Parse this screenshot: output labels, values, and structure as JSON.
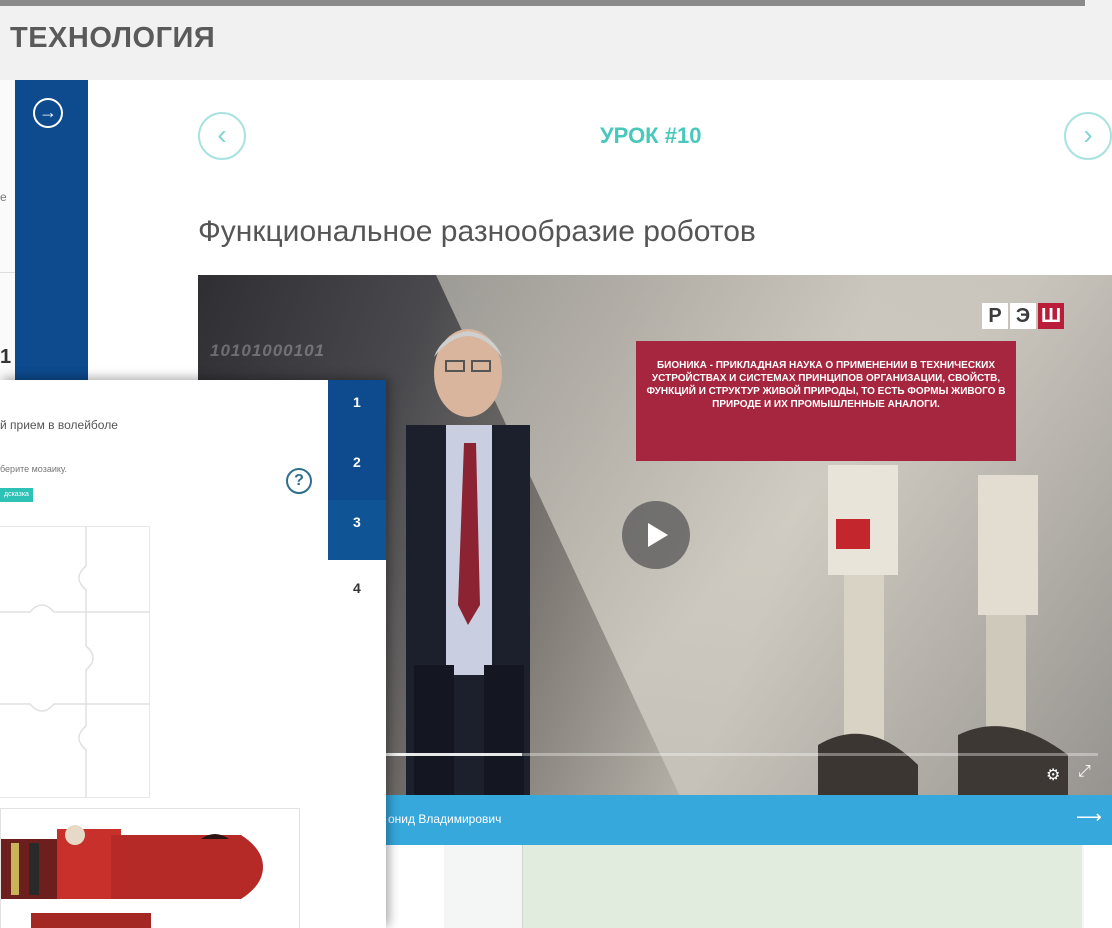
{
  "header": {
    "title": "ТЕХНОЛОГИЯ"
  },
  "sidebar": {
    "expand_icon": "arrow-right-circle-icon"
  },
  "left_panel": {
    "number": "1",
    "text_fragment": "е"
  },
  "lesson": {
    "prev_icon": "chevron-left-icon",
    "next_icon": "chevron-right-icon",
    "number_label": "УРОК #10",
    "title": "Функциональное разнообразие роботов"
  },
  "video": {
    "binary_text": "10101000101",
    "logo": [
      "Р",
      "Э",
      "Ш"
    ],
    "caption": "БИОНИКА - ПРИКЛАДНАЯ НАУКА О ПРИМЕНЕНИИ В ТЕХНИЧЕСКИХ УСТРОЙСТВАХ И СИСТЕМАХ ПРИНЦИПОВ ОРГАНИЗАЦИИ, СВОЙСТВ, ФУНКЦИЙ И СТРУКТУР ЖИВОЙ ПРИРОДЫ, ТО ЕСТЬ ФОРМЫ ЖИВОГО В ПРИРОДЕ И ИХ ПРОМЫШЛЕННЫЕ АНАЛОГИ.",
    "progress_fraction": 0.36,
    "author": "онид Владимирович"
  },
  "exercise": {
    "question": "й прием в волейболе",
    "instruction": "берите мозаику.",
    "badge": "дсказка",
    "help_icon": "question-circle-icon",
    "steps": [
      "1",
      "2",
      "3",
      "4"
    ],
    "active_step": "3"
  },
  "colors": {
    "sidebar_blue": "#0d4a8e",
    "accent_teal": "#48c8bb",
    "info_bar_blue": "#36a8dc",
    "caption_red": "#a6263f"
  }
}
